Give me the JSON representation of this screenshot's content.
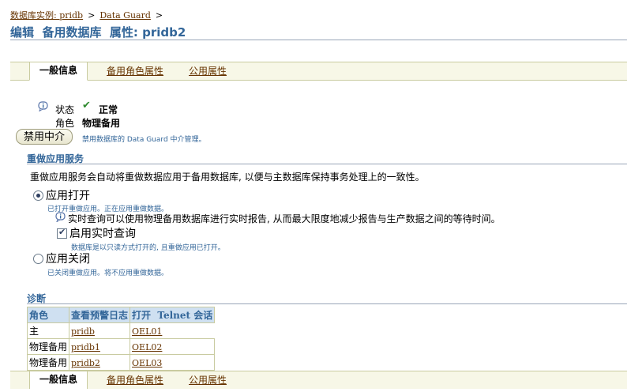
{
  "breadcrumb": {
    "instance_link": "数据库实例: pridb",
    "sep1": ">",
    "dataguard_link": "Data Guard",
    "sep2": ">"
  },
  "page_title": "编辑  备用数据库  属性: pridb2",
  "tabs": [
    {
      "label": "一般信息",
      "active": true
    },
    {
      "label": "备用角色属性",
      "active": false
    },
    {
      "label": "公用属性",
      "active": false
    }
  ],
  "status": {
    "status_label": "状态",
    "status_value": "正常",
    "role_label": "角色",
    "role_value": "物理备用"
  },
  "broker": {
    "button_label": "禁用中介",
    "hint": "禁用数据库的 Data Guard 中介管理。"
  },
  "redo_apply": {
    "section_title": "重做应用服务",
    "description": "重做应用服务会自动将重做数据应用于备用数据库, 以便与主数据库保持事务处理上的一致性。",
    "apply_on_label": "应用打开",
    "apply_on_hint": "已打开重做应用。正在应用重做数据。",
    "realtime_info": "实时查询可以使用物理备用数据库进行实时报告, 从而最大限度地减少报告与生产数据之间的等待时间。",
    "realtime_label": "启用实时查询",
    "realtime_hint": "数据库是以只读方式打开的, 且重做应用已打开。",
    "apply_off_label": "应用关闭",
    "apply_off_hint": "已关闭重做应用。将不应用重做数据。"
  },
  "diagnostics": {
    "section_title": "诊断",
    "headers": [
      "角色",
      "查看预警日志",
      "打开",
      "Telnet 会话"
    ],
    "rows": [
      {
        "role": "主",
        "log": "pridb",
        "telnet": "OEL01"
      },
      {
        "role": "物理备用",
        "log": "pridb1",
        "telnet": "OEL02"
      },
      {
        "role": "物理备用",
        "log": "pridb2",
        "telnet": "OEL03"
      }
    ]
  },
  "colors": {
    "link": "#663300",
    "section_title": "#336699",
    "table_header_bg": "#cfe0f1",
    "tab_bar_bg": "#f7f7e7",
    "check_green": "#2f8a2f"
  },
  "icons": [
    "info-icon",
    "check-icon"
  ]
}
